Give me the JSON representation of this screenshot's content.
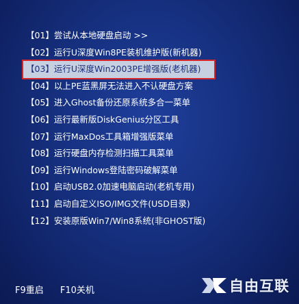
{
  "menu": {
    "items": [
      {
        "label": "【01】尝试从本地硬盘启动 >>"
      },
      {
        "label": "【02】运行U深度Win8PE装机维护版(新机器)"
      },
      {
        "label": "【03】运行U深度Win2003PE增强版(老机器)"
      },
      {
        "label": "【04】以上PE蓝黑屏无法进入不认硬盘方案"
      },
      {
        "label": "【05】进入Ghost备份还原系统多合一菜单"
      },
      {
        "label": "【06】运行最新版DiskGenius分区工具"
      },
      {
        "label": "【07】运行MaxDos工具箱增强版菜单"
      },
      {
        "label": "【08】运行硬盘内存检测扫描工具菜单"
      },
      {
        "label": "【09】运行Windows登陆密码破解菜单"
      },
      {
        "label": "【10】启动USB2.0加速电脑启动(老机专用)"
      },
      {
        "label": "【11】启动自定义ISO/IMG文件(USD目录)"
      },
      {
        "label": "【12】安装原版Win7/Win8系统(非GHOST版)"
      }
    ],
    "selected_index": 2
  },
  "hotkeys": {
    "f9": "F9重启",
    "f10": "F10关机"
  },
  "watermark": {
    "text": "自由互联",
    "icon": "x-logo-icon"
  },
  "colors": {
    "background": "#16307f",
    "highlight_bg": "#c7d0e1",
    "highlight_text": "#1b2f7e",
    "highlight_border": "#d6262a"
  }
}
